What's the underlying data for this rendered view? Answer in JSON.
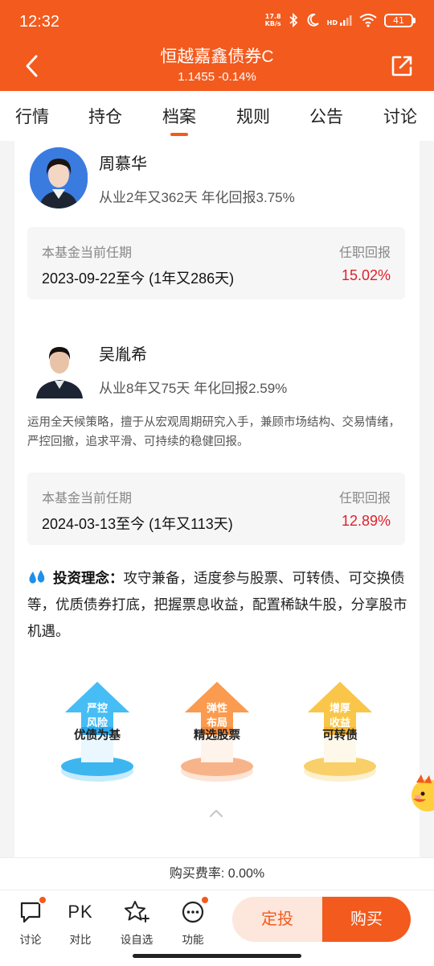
{
  "status_bar": {
    "time": "12:32",
    "speed_value": "17.8",
    "speed_unit": "KB/s",
    "network": "HD",
    "battery": "41"
  },
  "header": {
    "title": "恒越嘉鑫债券C",
    "subtitle": "1.1455 -0.14%"
  },
  "tabs": [
    {
      "label": "行情"
    },
    {
      "label": "持仓"
    },
    {
      "label": "档案",
      "active": true
    },
    {
      "label": "规则"
    },
    {
      "label": "公告"
    },
    {
      "label": "讨论"
    }
  ],
  "managers": [
    {
      "name": "周慕华",
      "meta": "从业2年又362天 年化回报3.75%",
      "tenure_label": "本基金当前任期",
      "tenure_return_label": "任职回报",
      "tenure_period": "2023-09-22至今 (1年又286天)",
      "tenure_return": "15.02%"
    },
    {
      "name": "吴胤希",
      "meta": "从业8年又75天 年化回报2.59%",
      "description": "运用全天候策略，擅于从宏观周期研究入手，兼顾市场结构、交易情绪，严控回撤，追求平滑、可持续的稳健回报。",
      "tenure_label": "本基金当前任期",
      "tenure_return_label": "任职回报",
      "tenure_period": "2024-03-13至今 (1年又113天)",
      "tenure_return": "12.89%"
    }
  ],
  "philosophy": {
    "label": "投资理念：",
    "text": "攻守兼备，适度参与股票、可转债、可交换债等，优质债券打底，把握票息收益，配置稀缺牛股，分享股市机遇。"
  },
  "pillars": [
    {
      "line1": "严控",
      "line2": "风险",
      "label": "优债为基",
      "color": "#2aa8ee",
      "base": "#3db6f0"
    },
    {
      "line1": "弹性",
      "line2": "布局",
      "label": "精选股票",
      "color": "#f78a3a",
      "base": "#f7b48a"
    },
    {
      "line1": "增厚",
      "line2": "收益",
      "label": "可转债",
      "color": "#f6b52c",
      "base": "#f9cf6a"
    }
  ],
  "fee_bar": {
    "text": "购买费率: 0.00%"
  },
  "bottom_bar": {
    "discuss_label": "讨论",
    "pk_text": "PK",
    "compare_label": "对比",
    "watch_label": "设自选",
    "function_label": "功能",
    "dingtou_label": "定投",
    "buy_label": "购买"
  },
  "colors": {
    "brand": "#f35a1d",
    "up_red": "#e0202a"
  }
}
